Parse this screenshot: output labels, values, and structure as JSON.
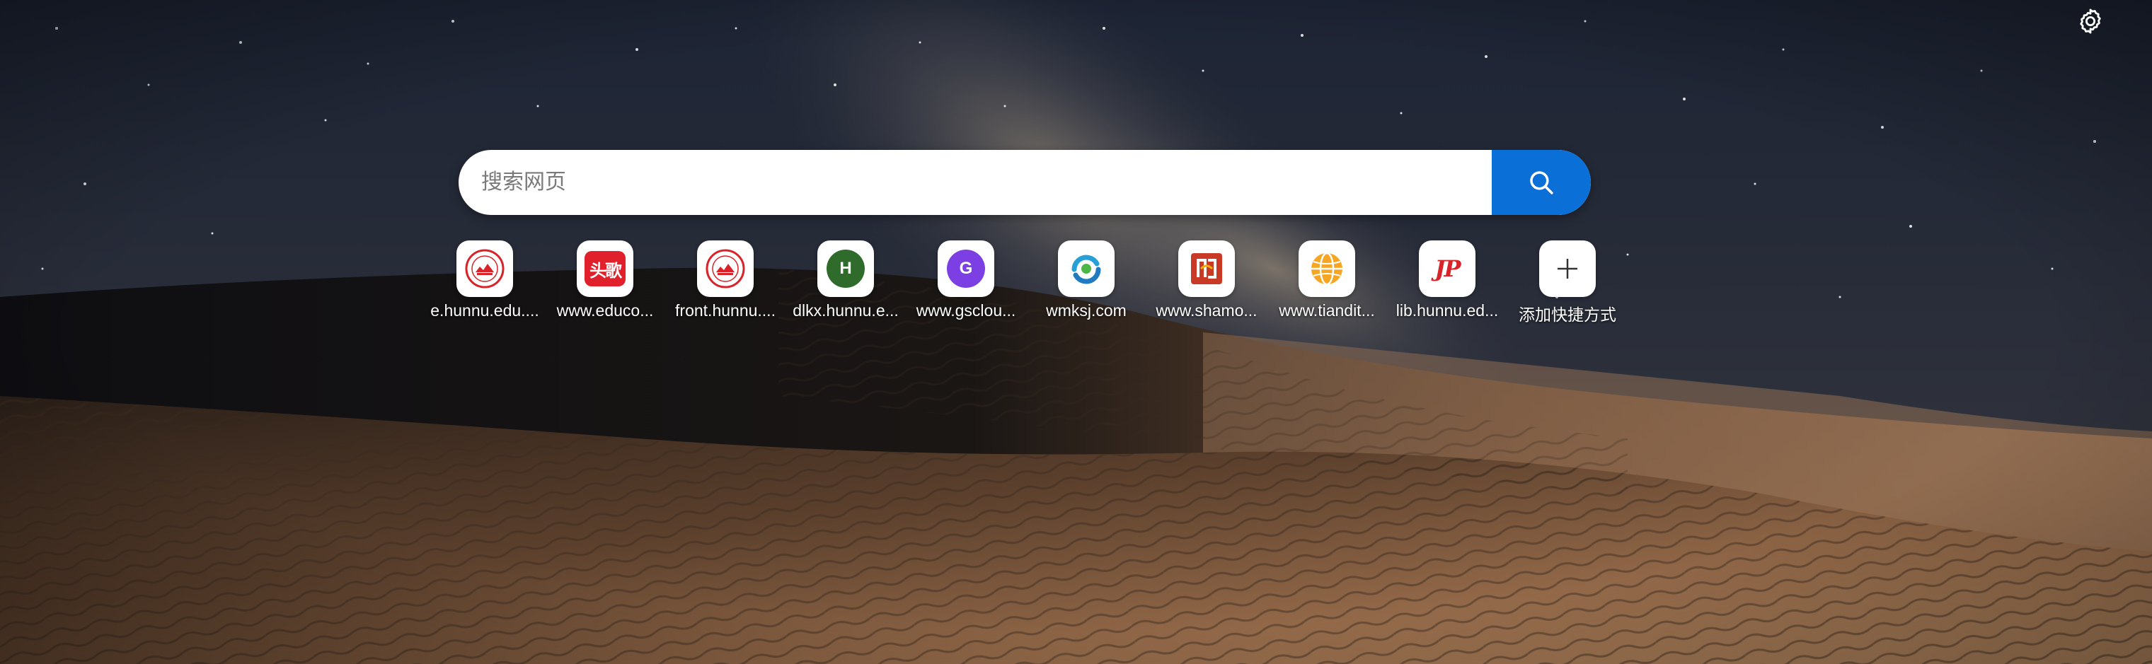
{
  "search": {
    "placeholder": "搜索网页"
  },
  "settings": {
    "icon": "gear-icon"
  },
  "quick_links": [
    {
      "label": "e.hunnu.edu....",
      "icon": "hunnu-seal-icon"
    },
    {
      "label": "www.educo...",
      "icon": "toutiao-logo-icon",
      "glyph": "头歌"
    },
    {
      "label": "front.hunnu....",
      "icon": "hunnu-seal-icon"
    },
    {
      "label": "dlkx.hunnu.e...",
      "icon": "letter-h-icon",
      "glyph": "H",
      "color": "#2f6b2a"
    },
    {
      "label": "www.gsclou...",
      "icon": "letter-g-icon",
      "glyph": "G",
      "color": "#7b3fe4"
    },
    {
      "label": "wmksj.com",
      "icon": "wmksj-logo-icon"
    },
    {
      "label": "www.shamo...",
      "icon": "shamo-logo-icon"
    },
    {
      "label": "www.tiandit...",
      "icon": "tianditu-globe-icon"
    },
    {
      "label": "lib.hunnu.ed...",
      "icon": "jp-logo-icon",
      "glyph": "JP"
    },
    {
      "label": "添加快捷方式",
      "icon": "plus-icon"
    }
  ],
  "colors": {
    "search_button": "#0a6fd6",
    "toutiao_red": "#e0212b",
    "hunnu_red": "#d8232a"
  }
}
